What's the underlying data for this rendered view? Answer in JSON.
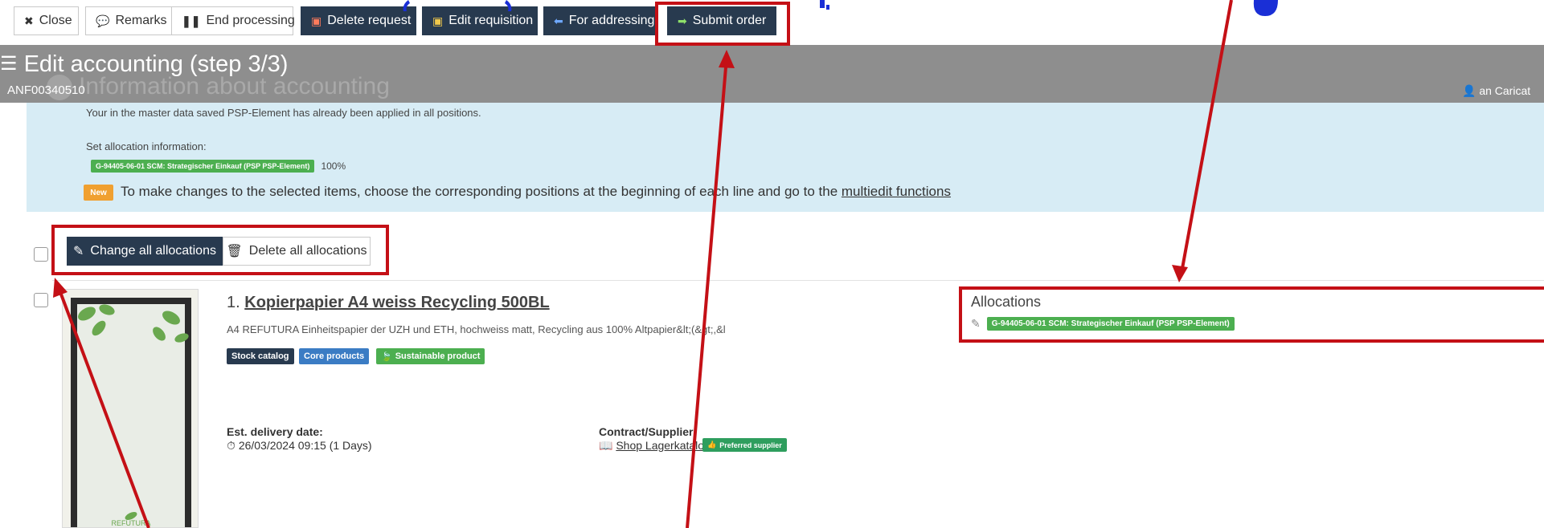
{
  "toolbar": {
    "close_label": "Close",
    "remarks_label": "Remarks",
    "end_processing_label": "End processing",
    "delete_request_label": "Delete request",
    "edit_requisition_label": "Edit requisition",
    "for_addressing_label": "For addressing",
    "submit_order_label": "Submit order"
  },
  "header": {
    "title": "Edit accounting (step 3/3)",
    "requisition_id": "ANF00340510",
    "section_title": "Information about accounting",
    "user": "an Caricat"
  },
  "info": {
    "line1": "Your in the master data saved PSP-Element has already been applied in all positions.",
    "set_allocation_label": "Set allocation information:",
    "allocation_tag": "G-94405-06-01 SCM: Strategischer Einkauf (PSP PSP-Element)",
    "allocation_percent": "100%",
    "new_badge": "New",
    "hint_text": "To make changes to the selected items, choose the corresponding positions at the beginning of each line and go to the",
    "hint_link": "multiedit functions"
  },
  "bulk": {
    "change_all_label": "Change all allocations",
    "delete_all_label": "Delete all allocations"
  },
  "item": {
    "number": "1.",
    "name": "Kopierpapier A4 weiss Recycling 500BL",
    "description": "A4 REFUTURA Einheitspapier der UZH und ETH, hochweiss matt, Recycling aus 100% Altpapier&lt;(&gt;,&l",
    "badges": [
      "Stock catalog",
      "Core products",
      "Sustainable product"
    ],
    "est_delivery_label": "Est. delivery date:",
    "est_delivery_value": "26/03/2024 09:15 (1 Days)",
    "contract_label": "Contract/Supplier",
    "supplier_link": "Shop Lagerkatalog...",
    "preferred_badge": "Preferred supplier",
    "image_caption": "REFUTURA"
  },
  "allocations": {
    "title": "Allocations",
    "tag": "G-94405-06-01 SCM: Strategischer Einkauf (PSP PSP-Element)"
  },
  "colors": {
    "toolbar_dark": "#283a4f",
    "header_gray": "#8e8e8e",
    "info_bg": "#d7ecf5",
    "allocation_green": "#4caf50",
    "annotation_red": "#c41016",
    "annotation_blue": "#1a2fd6"
  }
}
